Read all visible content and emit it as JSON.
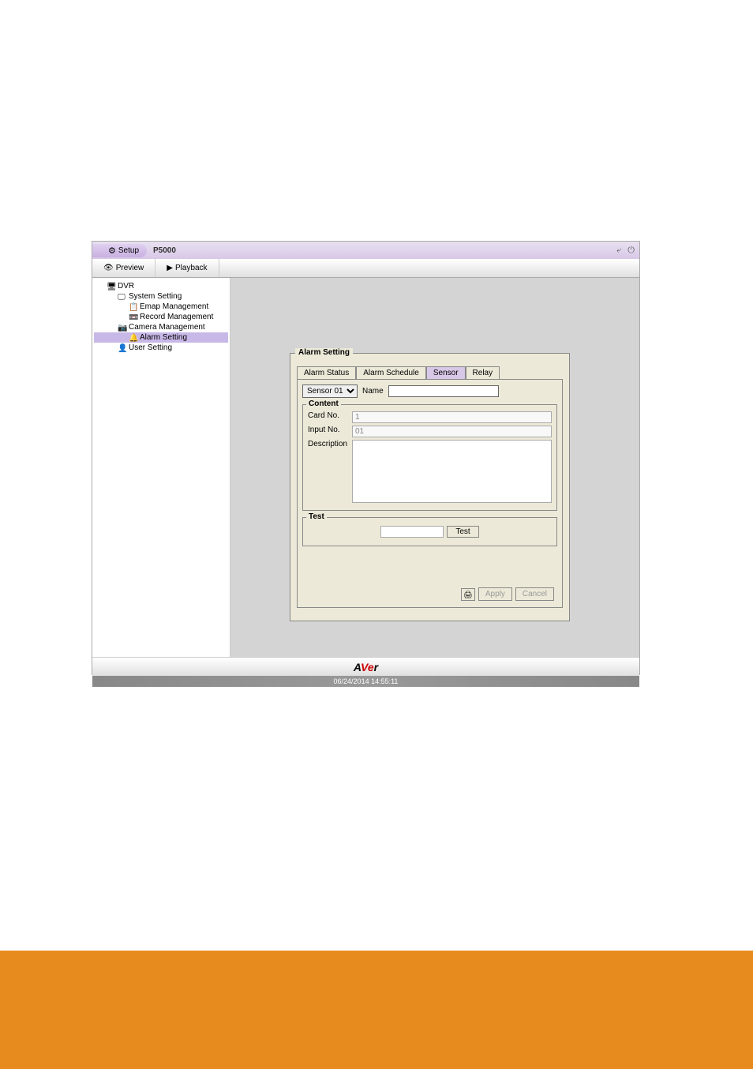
{
  "titlebar": {
    "setup": "Setup",
    "model": "P5000"
  },
  "toolbar": {
    "preview": "Preview",
    "playback": "Playback"
  },
  "tree": {
    "root": "DVR",
    "system": "System Setting",
    "emap": "Emap Management",
    "record": "Record Management",
    "camera": "Camera Management",
    "alarm": "Alarm Setting",
    "user": "User Setting"
  },
  "panel": {
    "title": "Alarm Setting",
    "tabs": {
      "status": "Alarm Status",
      "schedule": "Alarm Schedule",
      "sensor": "Sensor",
      "relay": "Relay"
    },
    "sensor_select": "Sensor 01",
    "name_label": "Name",
    "name_value": "",
    "content": {
      "legend": "Content",
      "cardno_label": "Card No.",
      "cardno_value": "1",
      "inputno_label": "Input No.",
      "inputno_value": "01",
      "desc_label": "Description",
      "desc_value": ""
    },
    "test": {
      "legend": "Test",
      "button": "Test",
      "value": ""
    },
    "buttons": {
      "apply": "Apply",
      "cancel": "Cancel"
    }
  },
  "logo": "AVer",
  "datetime": "06/24/2014 14:55:11"
}
